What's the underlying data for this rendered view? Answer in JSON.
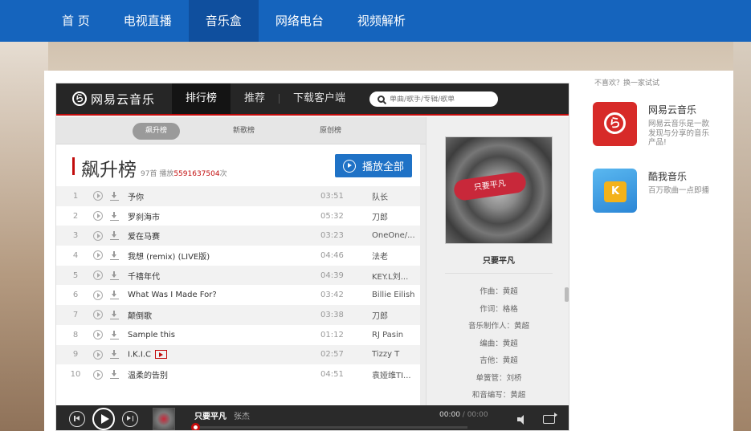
{
  "nav": {
    "items": [
      {
        "label": "首 页"
      },
      {
        "label": "电视直播"
      },
      {
        "label": "音乐盒"
      },
      {
        "label": "网络电台"
      },
      {
        "label": "视频解析"
      }
    ]
  },
  "player": {
    "logo": {
      "mark": "ら",
      "text": "网易云音乐"
    },
    "tabs": [
      {
        "label": "排行榜"
      },
      {
        "label": "推荐"
      },
      {
        "label": "下载客户端"
      }
    ],
    "search": {
      "placeholder": "单曲/歌手/专辑/歌单"
    },
    "subtabs": [
      {
        "label": "飙升榜"
      },
      {
        "label": "新歌榜"
      },
      {
        "label": "原创榜"
      }
    ],
    "list": {
      "title": "飙升榜",
      "count_prefix": "97首 播放",
      "play_count": "5591637504",
      "count_suffix": "次",
      "play_all": "播放全部"
    },
    "songs": [
      {
        "idx": "1",
        "name": "予你",
        "time": "03:51",
        "artist": "队长"
      },
      {
        "idx": "2",
        "name": "罗刹海市",
        "time": "05:32",
        "artist": "刀郎"
      },
      {
        "idx": "3",
        "name": "爱在马赛",
        "time": "03:23",
        "artist": "OneOne/..."
      },
      {
        "idx": "4",
        "name": "我想 (remix) (LIVE版)",
        "time": "04:46",
        "artist": "法老"
      },
      {
        "idx": "5",
        "name": "千禧年代",
        "time": "04:39",
        "artist": "KEY.L刘..."
      },
      {
        "idx": "6",
        "name": "What Was I Made For?",
        "time": "03:42",
        "artist": "Billie Eilish"
      },
      {
        "idx": "7",
        "name": "颠倒歌",
        "time": "03:38",
        "artist": "刀郎"
      },
      {
        "idx": "8",
        "name": "Sample this",
        "time": "01:12",
        "artist": "RJ Pasin"
      },
      {
        "idx": "9",
        "name": "I.K.I.C",
        "time": "02:57",
        "artist": "Tizzy T"
      },
      {
        "idx": "10",
        "name": "温柔的告别",
        "time": "04:51",
        "artist": "袁娅维TI..."
      }
    ],
    "side": {
      "cover_text": "只要平凡",
      "song_title": "只要平凡",
      "credits": [
        {
          "text": "作曲：黄超"
        },
        {
          "text": "作词：格格"
        },
        {
          "text": "音乐制作人：黄超"
        },
        {
          "text": "编曲：黄超"
        },
        {
          "text": "吉他：黄超"
        },
        {
          "text": "单簧管：刘桥"
        },
        {
          "text": "和音编写：黄超"
        }
      ]
    },
    "bar": {
      "now_title": "只要平凡",
      "now_artist": "张杰",
      "time": "00:00",
      "duration": " / 00:00",
      "progress": 0
    }
  },
  "reco": {
    "hint": "不喜欢？换一家试试",
    "apps": [
      {
        "name": "网易云音乐",
        "desc": "网易云音乐是一款发现与分享的音乐产品!",
        "icon": "netease-music-icon",
        "mark": "ら"
      },
      {
        "name": "酷我音乐",
        "desc": "百万歌曲一点即播",
        "icon": "kuwo-music-icon",
        "mark": "K"
      }
    ]
  },
  "colors": {
    "nav": "#1564bd",
    "nav_active": "#0f4f9e",
    "accent_red": "#c20c0c",
    "play_all": "#1f72c6"
  }
}
